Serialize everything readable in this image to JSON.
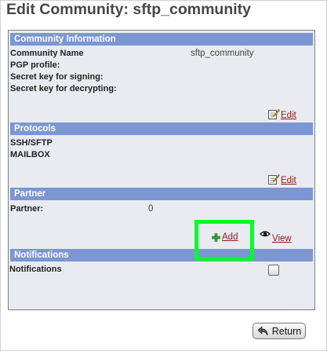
{
  "page": {
    "title": "Edit Community: sftp_community"
  },
  "sections": {
    "community_information": {
      "header": "Community Information",
      "fields": [
        {
          "label": "Community Name",
          "value": "sftp_community"
        },
        {
          "label": "PGP profile:",
          "value": ""
        },
        {
          "label": "Secret key for signing:",
          "value": ""
        },
        {
          "label": "Secret key for decrypting:",
          "value": ""
        }
      ],
      "edit_label": "Edit"
    },
    "protocols": {
      "header": "Protocols",
      "items": [
        "SSH/SFTP",
        "MAILBOX"
      ],
      "edit_label": "Edit"
    },
    "partner": {
      "header": "Partner",
      "label": "Partner:",
      "value": "0",
      "add_label": "Add",
      "view_label": "View"
    },
    "notifications": {
      "header": "Notifications",
      "label": "Notifications",
      "checked": false
    }
  },
  "footer": {
    "return_label": "Return"
  },
  "colors": {
    "header_bg": "#7b96d2",
    "panel_bg": "#e9ebf1",
    "link": "#8b1a1a",
    "highlight": "#00ff26"
  },
  "icons": [
    "edit-icon",
    "plus-icon",
    "eye-icon",
    "return-arrow-icon"
  ]
}
